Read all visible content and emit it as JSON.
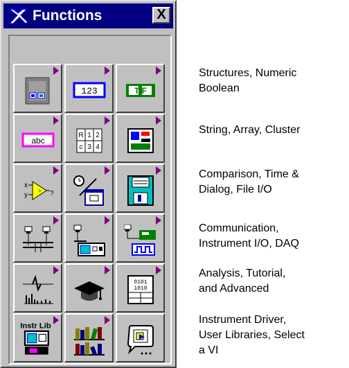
{
  "window": {
    "title": "Functions",
    "close_label": "X"
  },
  "palette": [
    [
      {
        "icon": "structures-icon"
      },
      {
        "icon": "numeric-icon",
        "text": "123"
      },
      {
        "icon": "boolean-icon",
        "text": "T F"
      }
    ],
    [
      {
        "icon": "string-icon",
        "text": "abc"
      },
      {
        "icon": "array-icon",
        "text": "R 1 2 c 3 4"
      },
      {
        "icon": "cluster-icon"
      }
    ],
    [
      {
        "icon": "comparison-icon",
        "text": "x y ?"
      },
      {
        "icon": "time-dialog-icon"
      },
      {
        "icon": "file-io-icon"
      }
    ],
    [
      {
        "icon": "communication-icon"
      },
      {
        "icon": "instrument-io-icon"
      },
      {
        "icon": "daq-icon"
      }
    ],
    [
      {
        "icon": "analysis-icon"
      },
      {
        "icon": "tutorial-icon"
      },
      {
        "icon": "advanced-icon",
        "text": "0101"
      }
    ],
    [
      {
        "icon": "instrument-driver-icon",
        "text": "Instr Lib"
      },
      {
        "icon": "user-libraries-icon"
      },
      {
        "icon": "select-vi-icon"
      }
    ]
  ],
  "descriptions": [
    [
      "Structures, Numeric",
      "Boolean"
    ],
    [
      "String, Array, Cluster"
    ],
    [
      "Comparison, Time &",
      "Dialog, File I/O"
    ],
    [
      "Communication,",
      "Instrument I/O, DAQ"
    ],
    [
      "Analysis, Tutorial,",
      "and Advanced"
    ],
    [
      "Instrument Driver,",
      "User Libraries, Select",
      "a VI"
    ]
  ]
}
